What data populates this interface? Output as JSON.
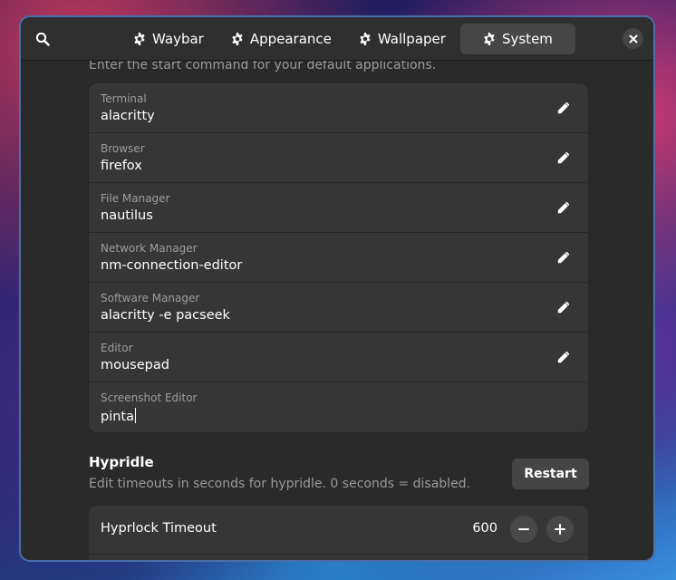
{
  "header": {
    "tabs": [
      {
        "label": "Waybar",
        "icon": "gear-icon",
        "active": false
      },
      {
        "label": "Appearance",
        "icon": "gear-icon",
        "active": false
      },
      {
        "label": "Wallpaper",
        "icon": "gear-icon",
        "active": false
      },
      {
        "label": "System",
        "icon": "gear-icon",
        "active": true
      }
    ]
  },
  "apps": {
    "description": "Enter the start command for your default applications.",
    "rows": [
      {
        "label": "Terminal",
        "value": "alacritty"
      },
      {
        "label": "Browser",
        "value": "firefox"
      },
      {
        "label": "File Manager",
        "value": "nautilus"
      },
      {
        "label": "Network Manager",
        "value": "nm-connection-editor"
      },
      {
        "label": "Software Manager",
        "value": "alacritty -e pacseek"
      },
      {
        "label": "Editor",
        "value": "mousepad"
      },
      {
        "label": "Screenshot Editor",
        "value": "pinta"
      }
    ]
  },
  "hypridle": {
    "title": "Hypridle",
    "description": "Edit timeouts in seconds for hypridle. 0 seconds = disabled.",
    "restart_label": "Restart",
    "rows": [
      {
        "label": "Hyprlock Timeout",
        "value": "600"
      }
    ]
  },
  "colors": {
    "window_bg": "#2a2a2a",
    "card_bg": "#363636",
    "accent_border": "#4a6ea8"
  }
}
